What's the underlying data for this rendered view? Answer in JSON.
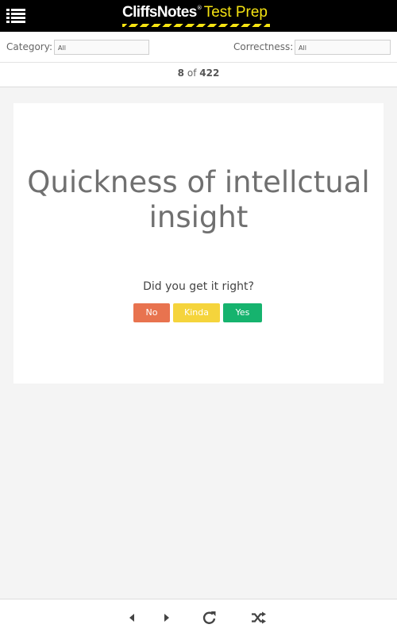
{
  "header": {
    "menu_icon": "hamburger-list-icon",
    "logo_brand": "CliffsNotes",
    "logo_reg": "®",
    "logo_product": "Test Prep",
    "colors": {
      "background": "#000000",
      "accent": "#f5e312"
    }
  },
  "filters": {
    "category_label": "Category:",
    "category_value": "All",
    "correctness_label": "Correctness:",
    "correctness_value": "All"
  },
  "counter": {
    "current": "8",
    "of": "of",
    "total": "422"
  },
  "card": {
    "term": "Quickness of intellctual insight",
    "prompt": "Did you get it right?",
    "buttons": {
      "no": "No",
      "kinda": "Kinda",
      "yes": "Yes"
    },
    "colors": {
      "no": "#e8734f",
      "kinda": "#f5d43c",
      "yes": "#16b36e"
    }
  },
  "footer": {
    "icons": [
      "previous-icon",
      "next-icon",
      "refresh-icon",
      "shuffle-icon"
    ]
  }
}
